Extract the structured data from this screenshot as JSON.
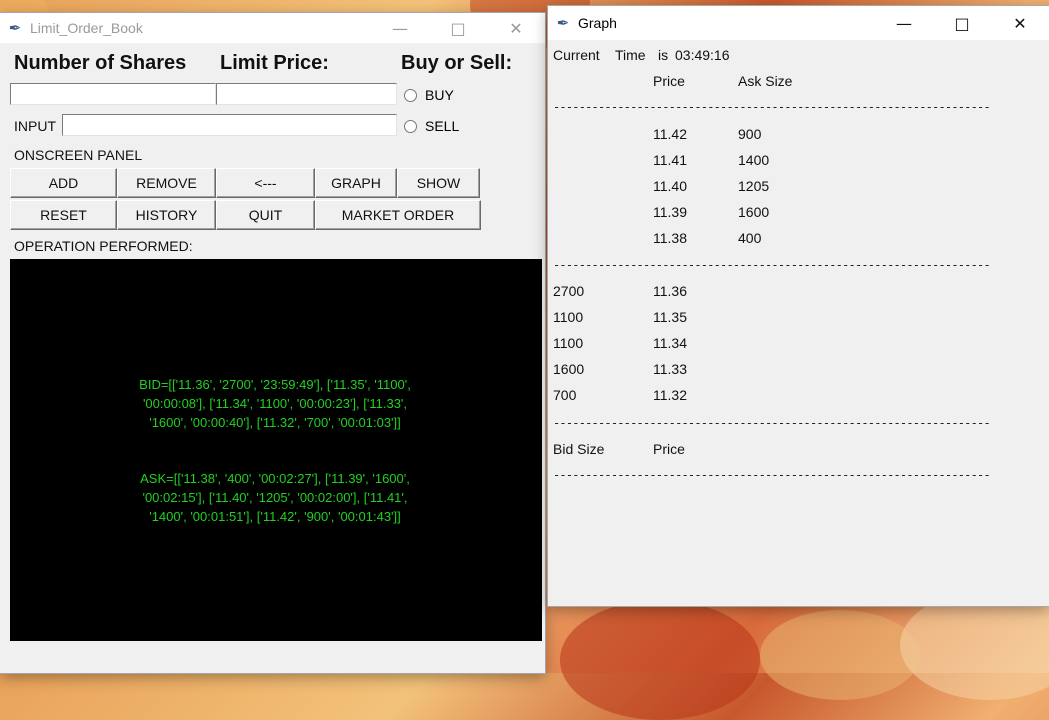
{
  "left_window": {
    "title": "Limit_Order_Book",
    "labels": {
      "shares": "Number of Shares",
      "limit_price": "Limit Price:",
      "buy_or_sell": "Buy or Sell:",
      "input": "INPUT",
      "onscreen_panel": "ONSCREEN PANEL",
      "operation": "OPERATION PERFORMED:"
    },
    "fields": {
      "shares_value": "",
      "price_value": "",
      "input_value": ""
    },
    "radios": {
      "buy": "BUY",
      "sell": "SELL"
    },
    "buttons": {
      "add": "ADD",
      "remove": "REMOVE",
      "back": "<---",
      "graph": "GRAPH",
      "show": "SHOW",
      "reset": "RESET",
      "history": "HISTORY",
      "quit": "QUIT",
      "market_order": "MARKET ORDER"
    },
    "console": {
      "bid_lines": [
        "BID=[['11.36', '2700', '23:59:49'], ['11.35', '1100',",
        "'00:00:08'], ['11.34', '1100', '00:00:23'], ['11.33',",
        "'1600', '00:00:40'], ['11.32', '700', '00:01:03']]"
      ],
      "ask_lines": [
        "ASK=[['11.38', '400', '00:02:27'], ['11.39', '1600',",
        "'00:02:15'], ['11.40', '1205', '00:02:00'], ['11.41',",
        "'1400', '00:01:51'], ['11.42', '900', '00:01:43']]"
      ]
    }
  },
  "graph_window": {
    "title": "Graph",
    "current_time": {
      "label": "Current",
      "time_word": "Time",
      "is_word": "is",
      "value": "03:49:16"
    },
    "ask_header": {
      "price": "Price",
      "size": "Ask Size"
    },
    "divider": "--------------------------------------------------------------------",
    "asks": [
      {
        "price": "11.42",
        "size": "900"
      },
      {
        "price": "11.41",
        "size": "1400"
      },
      {
        "price": "11.40",
        "size": "1205"
      },
      {
        "price": "11.39",
        "size": "1600"
      },
      {
        "price": "11.38",
        "size": "400"
      }
    ],
    "bids": [
      {
        "size": "2700",
        "price": "11.36"
      },
      {
        "size": "1100",
        "price": "11.35"
      },
      {
        "size": "1100",
        "price": "11.34"
      },
      {
        "size": "1600",
        "price": "11.33"
      },
      {
        "size": "700",
        "price": "11.32"
      }
    ],
    "bid_header": {
      "size": "Bid Size",
      "price": "Price"
    }
  }
}
